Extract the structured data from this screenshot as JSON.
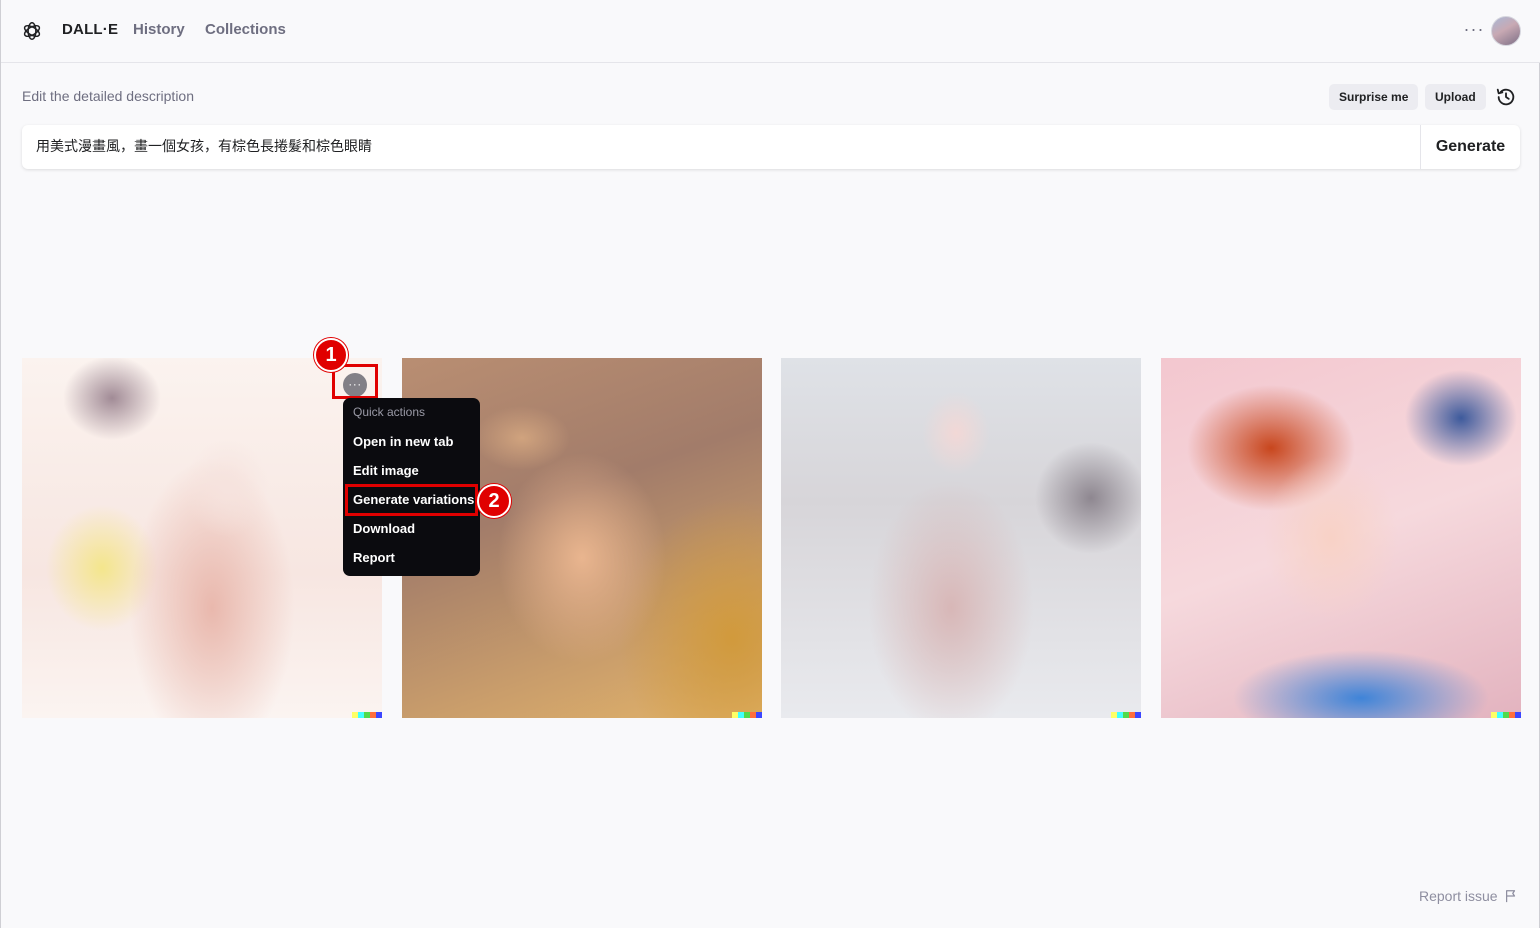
{
  "header": {
    "brand": "DALL·E",
    "nav": [
      {
        "label": "History"
      },
      {
        "label": "Collections"
      }
    ],
    "more_icon": "ellipsis-horizontal-icon",
    "avatar": "user-avatar"
  },
  "prompt": {
    "label": "Edit the detailed description",
    "surprise_label": "Surprise me",
    "upload_label": "Upload",
    "history_icon": "history-clock-icon",
    "value": "用美式漫畫風，畫一個女孩，有棕色長捲髮和棕色眼睛",
    "generate_label": "Generate"
  },
  "results": {
    "images": [
      {
        "alt": "image-1"
      },
      {
        "alt": "image-2"
      },
      {
        "alt": "image-3"
      },
      {
        "alt": "image-4"
      }
    ],
    "dots_label": "···"
  },
  "menu": {
    "heading": "Quick actions",
    "items": [
      {
        "label": "Open in new tab"
      },
      {
        "label": "Edit image"
      },
      {
        "label": "Generate variations"
      },
      {
        "label": "Download"
      },
      {
        "label": "Report"
      }
    ]
  },
  "annotations": {
    "badge1": "1",
    "badge2": "2",
    "highlight_color": "#e00000"
  },
  "footer": {
    "report_issue": "Report issue",
    "flag_icon": "flag-icon"
  }
}
